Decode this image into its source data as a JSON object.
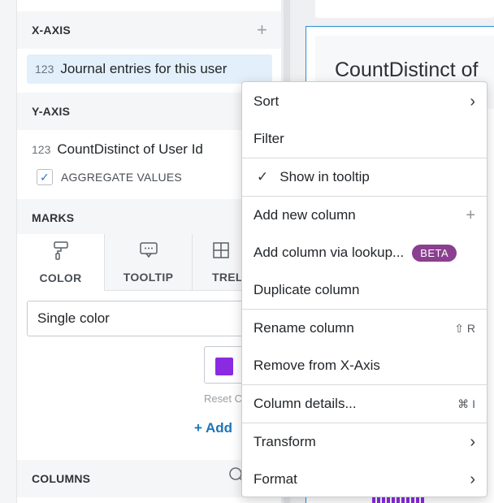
{
  "xaxis": {
    "header": "X-AXIS",
    "add_icon": "+",
    "field_type": "123",
    "field_label": "Journal entries for this user"
  },
  "yaxis": {
    "header": "Y-AXIS",
    "field_type": "123",
    "field_label": "CountDistinct of User Id",
    "aggregate_label": "AGGREGATE VALUES",
    "aggregate_checked": true
  },
  "marks": {
    "header": "MARKS",
    "tabs": [
      {
        "label": "COLOR",
        "icon": "paint-roller-icon"
      },
      {
        "label": "TOOLTIP",
        "icon": "speech-bubble-icon"
      },
      {
        "label": "TREL",
        "icon": "grid-icon"
      }
    ],
    "color_mode": "Single color",
    "swatch_color": "#8a2be2",
    "reset_label": "Reset C",
    "add_label": "+ Add"
  },
  "columns": {
    "header": "COLUMNS"
  },
  "chart": {
    "title": "CountDistinct of"
  },
  "menu": {
    "sort": "Sort",
    "filter": "Filter",
    "show_in_tooltip": "Show in tooltip",
    "add_new_column": "Add new column",
    "add_new_column_icon": "+",
    "add_via_lookup": "Add column via lookup...",
    "beta_badge": "BETA",
    "duplicate_column": "Duplicate column",
    "rename_column": "Rename column",
    "rename_shortcut": "⇧ R",
    "remove_from_axis": "Remove from X-Axis",
    "column_details": "Column details...",
    "details_shortcut": "⌘ I",
    "transform": "Transform",
    "format": "Format"
  },
  "colors": {
    "accent_blue": "#1f74b8",
    "beta_purple": "#8b3f8f",
    "series_purple": "#8a2be2"
  }
}
